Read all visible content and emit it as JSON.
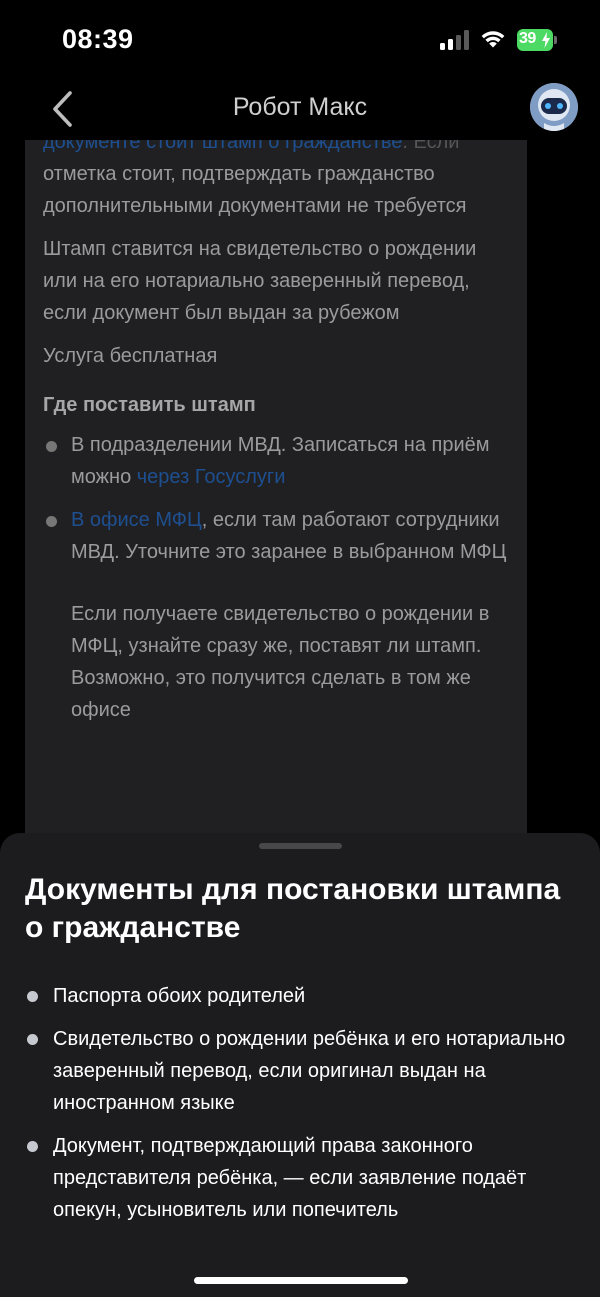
{
  "status": {
    "time": "08:39",
    "battery": "39"
  },
  "nav": {
    "title": "Робот Макс"
  },
  "background": {
    "partial_link_top": "документе стоит штамп о гражданстве",
    "partial_text_top": ". Если",
    "para1": "отметка стоит, подтверждать гражданство дополнительными документами не требуется",
    "para2": "Штамп ставится на свидетельство о рождении или на его нотариально заверенный перевод, если документ был выдан за рубежом",
    "para3": "Услуга бесплатная",
    "heading": "Где поставить штамп",
    "items": [
      {
        "text_before": "В подразделении МВД. Записаться на приём можно ",
        "link": "через Госуслуги",
        "text_after": ""
      },
      {
        "text_before": "",
        "link": "В офисе МФЦ",
        "text_after": ", если там работают сотрудники МВД. Уточните это заранее в выбранном МФЦ"
      }
    ],
    "extra": "Если получаете свидетельство о рождении в МФЦ, узнайте сразу же, поставят ли штамп. Возможно, это получится сделать в том же офисе"
  },
  "sheet": {
    "title": "Документы для постановки штампа о гражданстве",
    "items": [
      "Паспорта обоих родителей",
      "Свидетельство о рождении ребёнка и его нотариально заверенный перевод, если оригинал выдан на иностранном языке",
      "Документ, подтверждающий права законного представителя ребёнка, — если заявление подаёт опекун, усыновитель или попечитель"
    ]
  },
  "colors": {
    "accent_link": "#1e4f8f",
    "sheet_bg": "#1c1c1f",
    "battery": "#4cd964"
  }
}
